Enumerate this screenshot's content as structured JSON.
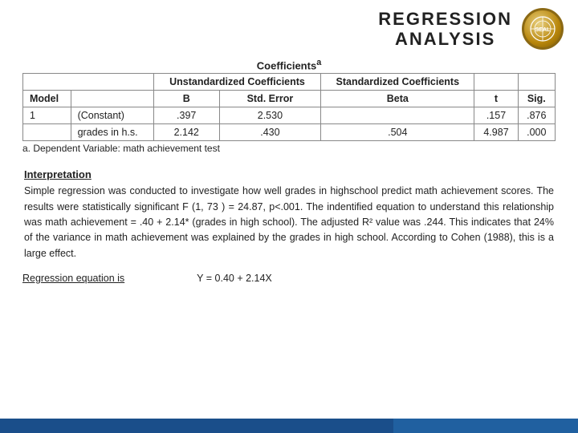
{
  "header": {
    "title_line1": "REGRESSION",
    "title_line2": "ANALYSIS"
  },
  "table": {
    "caption": "Coefficients",
    "caption_superscript": "a",
    "col_group_unstandardized": "Unstandardized Coefficients",
    "col_group_standardized": "Standardized Coefficients",
    "col_B": "B",
    "col_std_error": "Std. Error",
    "col_beta": "Beta",
    "col_t": "t",
    "col_sig": "Sig.",
    "col_model": "Model",
    "rows": [
      {
        "model": "1",
        "label": "(Constant)",
        "B": ".397",
        "std_error": "2.530",
        "beta": "",
        "t": ".157",
        "sig": ".876"
      },
      {
        "model": "",
        "label": "grades in h.s.",
        "B": "2.142",
        "std_error": ".430",
        "beta": ".504",
        "t": "4.987",
        "sig": ".000"
      }
    ],
    "footnote": "a. Dependent Variable: math achievement test"
  },
  "interpretation": {
    "heading": "Interpretation",
    "paragraph": "Simple regression was conducted to investigate how well grades in highschool predict math achievement scores. The results were statistically significant F (1, 73 ) = 24.87, p<.001. The indentified equation to understand this relationship was math achievement = .40 + 2.14* (grades in high school). The adjusted R² value was .244. This indicates that 24% of the variance in math achievement was explained by the grades in high school. According to Cohen (1988), this is a large effect."
  },
  "regression_equation": {
    "label": "Regression equation is",
    "formula": "Y = 0.40 + 2.14X"
  }
}
